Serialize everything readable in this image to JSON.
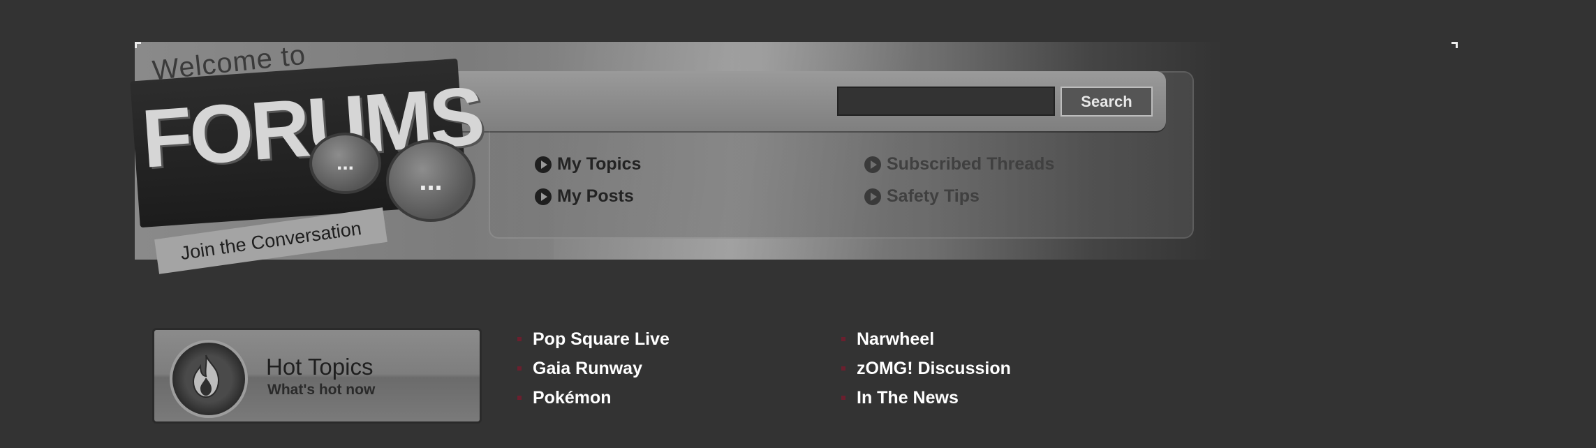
{
  "header": {
    "logo": {
      "welcome_text": "Welcome to",
      "word": "FORUMS",
      "tagline": "Join the Conversation",
      "bubble_text": "..."
    },
    "search": {
      "input_value": "",
      "button_label": "Search"
    },
    "nav_links": [
      {
        "label": "My Topics"
      },
      {
        "label": "My Posts"
      },
      {
        "label": "Subscribed Threads"
      },
      {
        "label": "Safety Tips"
      }
    ]
  },
  "hot_topics": {
    "title": "Hot Topics",
    "subtitle": "What's hot now",
    "icon": "flame-icon",
    "links": [
      {
        "label": "Pop Square Live"
      },
      {
        "label": "Gaia Runway"
      },
      {
        "label": "Pokémon"
      },
      {
        "label": "Narwheel"
      },
      {
        "label": "zOMG! Discussion"
      },
      {
        "label": "In The News"
      }
    ]
  },
  "colors": {
    "background": "#333333",
    "bullet": "#6b1f2e",
    "link_text": "#ffffff"
  }
}
